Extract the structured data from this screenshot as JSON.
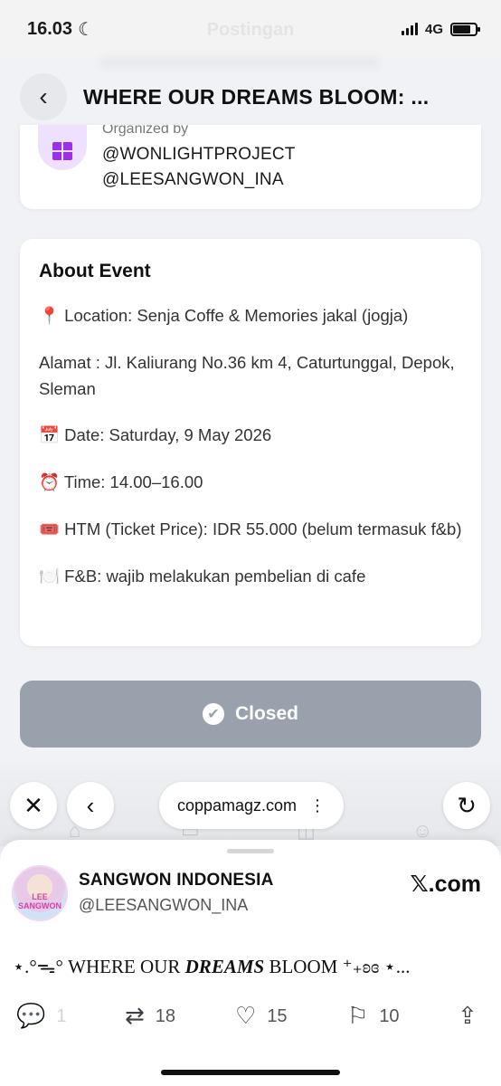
{
  "status_bar": {
    "time": "16.03",
    "network": "4G",
    "background_title": "Postingan"
  },
  "header": {
    "title": "WHERE OUR DREAMS BLOOM: ..."
  },
  "organizer": {
    "label": "Organized by",
    "handles": [
      "@WONLIGHTPROJECT",
      "@LEESANGWON_INA"
    ]
  },
  "about": {
    "title": "About Event",
    "lines": [
      {
        "emoji": "📍",
        "text": " Location:  Senja Coffe & Memories jakal (jogja)"
      },
      {
        "emoji": "",
        "text": "Alamat : Jl. Kaliurang No.36 km 4, Caturtunggal, Depok, Sleman"
      },
      {
        "emoji": "📅",
        "text": " Date: Saturday, 9 May 2026"
      },
      {
        "emoji": "⏰",
        "text": " Time: 14.00–16.00"
      },
      {
        "emoji": "🎟️",
        "text": " HTM (Ticket Price): IDR 55.000 (belum termasuk f&b)"
      },
      {
        "emoji": "🍽️",
        "text": " F&B: wajib melakukan pembelian di cafe"
      }
    ]
  },
  "closed_button": {
    "label": "Closed"
  },
  "browser": {
    "url": "coppamagz.com"
  },
  "tweet": {
    "account_name": "SANGWON INDONESIA",
    "account_handle": "@LEESANGWON_INA",
    "avatar_text": "LEE SANGWON",
    "source": "𝕏.com",
    "text_prefix": "⋆.°ᯓ° WHERE OUR ",
    "text_em": "DREAMS",
    "text_suffix": " BLOOM ⁺₊ʚɞ ⋆...",
    "replies": "1",
    "retweets": "18",
    "likes": "15",
    "bookmarks": "10"
  },
  "colors": {
    "closed_button_bg": "#99a1ac",
    "organizer_icon_bg": "#eee0ff",
    "organizer_icon_fg": "#9b30e8"
  },
  "icons": [
    "moon-icon",
    "signal-icon",
    "battery-icon",
    "back-arrow-icon",
    "building-icon",
    "check-circle-icon",
    "close-icon",
    "chevron-left-icon",
    "more-vertical-icon",
    "reload-icon",
    "reply-icon",
    "retweet-icon",
    "like-icon",
    "bookmark-icon",
    "share-icon"
  ]
}
